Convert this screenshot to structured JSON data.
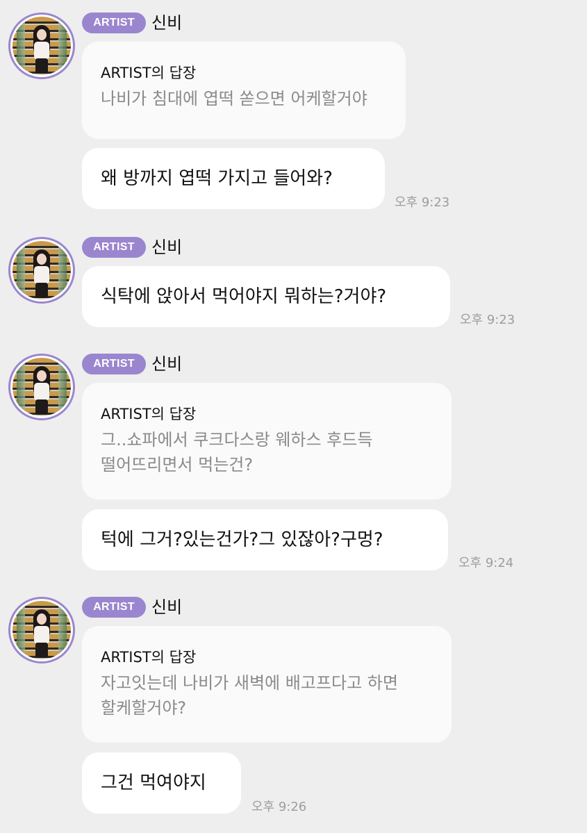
{
  "messages": [
    {
      "badge": "ARTIST",
      "sender": "신비",
      "reply_label": "ARTIST의 답장",
      "reply_lines": [
        "나비가 침대에 엽떡 쏟으면 어케할거야"
      ],
      "text": "왜 방까지 엽떡 가지고 들어와?",
      "time": "오후 9:23"
    },
    {
      "badge": "ARTIST",
      "sender": "신비",
      "text": "식탁에 앉아서 먹어야지 뭐하는?거야?",
      "time": "오후 9:23"
    },
    {
      "badge": "ARTIST",
      "sender": "신비",
      "reply_label": "ARTIST의 답장",
      "reply_lines": [
        "그..쇼파에서 쿠크다스랑 웨하스 후드득",
        "떨어뜨리면서 먹는건?"
      ],
      "text": "턱에 그거?있는건가?그 있잖아?구멍?",
      "time": "오후 9:24"
    },
    {
      "badge": "ARTIST",
      "sender": "신비",
      "reply_label": "ARTIST의 답장",
      "reply_lines": [
        "자고잇는데 나비가 새벽에 배고프다고 하면",
        "할케할거야?"
      ],
      "text": "그건 먹여야지",
      "time": "오후 9:26"
    }
  ]
}
